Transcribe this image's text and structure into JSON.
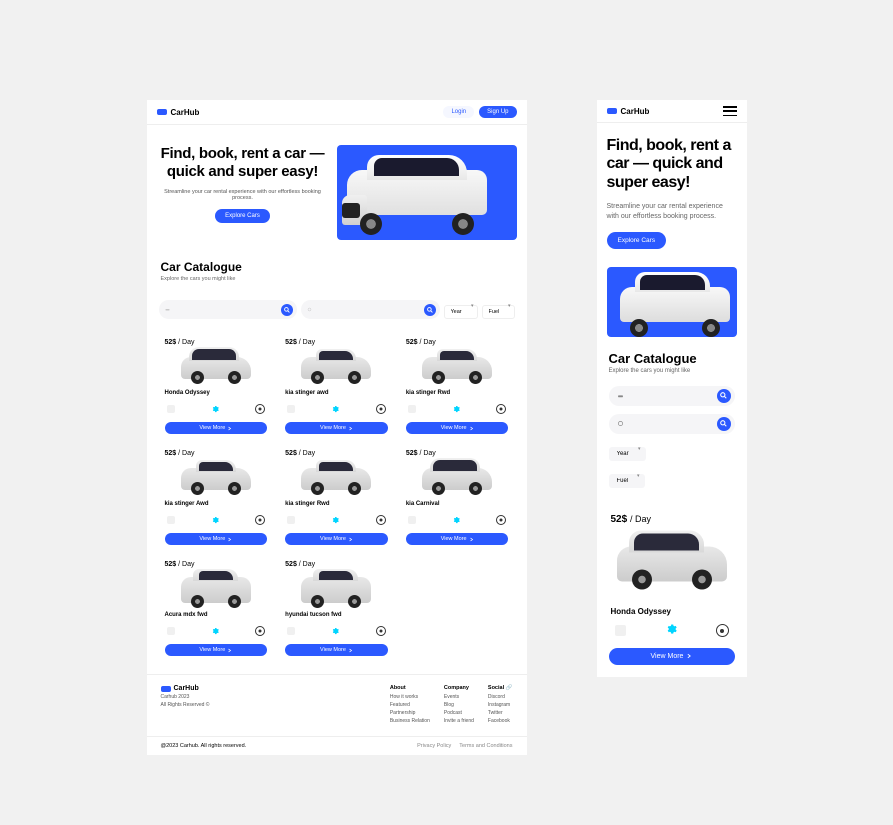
{
  "brand": {
    "name": "CarHub"
  },
  "auth": {
    "login": "Login",
    "signup": "Sign Up"
  },
  "hero": {
    "title": "Find, book, rent a car — quick and super easy!",
    "subtitle": "Streamline your car rental experience with our effortless booking process.",
    "cta": "Explore Cars"
  },
  "catalogue": {
    "title": "Car Catalogue",
    "subtitle": "Explore the cars you might like",
    "filters": {
      "year": "Year",
      "fuel": "Fuel"
    }
  },
  "cars": [
    {
      "price": "52$",
      "per": "/  Day",
      "name": "Honda Odyssey",
      "type": "van",
      "view": "View More"
    },
    {
      "price": "52$",
      "per": "/  Day",
      "name": "kia stinger awd",
      "type": "sedan",
      "view": "View More"
    },
    {
      "price": "52$",
      "per": "/  Day",
      "name": "kia stinger Rwd",
      "type": "sedan",
      "view": "View More"
    },
    {
      "price": "52$",
      "per": "/  Day",
      "name": "kia stinger Awd",
      "type": "sedan",
      "view": "View More"
    },
    {
      "price": "52$",
      "per": "/  Day",
      "name": "kia stinger Rwd",
      "type": "sedan",
      "view": "View More"
    },
    {
      "price": "52$",
      "per": "/  Day",
      "name": "kia Carnival",
      "type": "van",
      "view": "View More"
    },
    {
      "price": "52$",
      "per": "/  Day",
      "name": "Acura mdx fwd",
      "type": "suv-m",
      "view": "View More"
    },
    {
      "price": "52$",
      "per": "/  Day",
      "name": "hyundai tucson fwd",
      "type": "suv-m",
      "view": "View More"
    }
  ],
  "mobile_card": {
    "price": "52$",
    "per": "/  Day",
    "name": "Honda Odyssey",
    "view": "View More"
  },
  "footer": {
    "brand_sub": "Carhub 2023",
    "rights": "All Rights Reserved ©",
    "about": {
      "title": "About",
      "items": [
        "How it works",
        "Featured",
        "Partnership",
        "Business Relation"
      ]
    },
    "company": {
      "title": "Company",
      "items": [
        "Events",
        "Blog",
        "Podcast",
        "Invite a friend"
      ]
    },
    "social": {
      "title": "Social",
      "items": [
        "Discord",
        "Instagram",
        "Twitter",
        "Facebook"
      ]
    }
  },
  "copyright": {
    "text": "@2023 Carhub. All rights reserved.",
    "privacy": "Privacy Policy",
    "terms": "Terms and Conditions"
  }
}
